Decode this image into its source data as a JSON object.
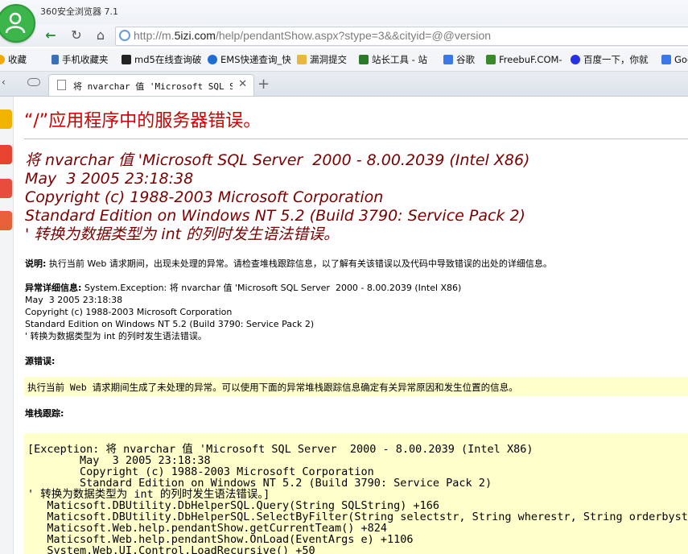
{
  "window": {
    "title": "360安全浏览器 7.1"
  },
  "address_bar": {
    "url_prefix": "http://m.",
    "url_domain": "5izi.com",
    "url_rest": "/help/pendantShow.aspx?stype=3&&cityid=@@version"
  },
  "bookmarks": [
    {
      "label": "收藏",
      "icon": "favorites-icon",
      "color": "#f2a900"
    },
    {
      "label": "手机收藏夹",
      "icon": "phone-icon",
      "color": "#3b6fb6"
    },
    {
      "label": "md5在线查询破",
      "icon": "grid-icon",
      "color": "#222222"
    },
    {
      "label": "EMS快递查询_快",
      "icon": "ie-icon",
      "color": "#1e6fd0"
    },
    {
      "label": "漏洞提交",
      "icon": "folder-icon",
      "color": "#e7b740"
    },
    {
      "label": "站长工具 - 站",
      "icon": "chart-icon",
      "color": "#2a7a2a"
    },
    {
      "label": "谷歌",
      "icon": "google-icon",
      "color": "#3b78e7"
    },
    {
      "label": "FreebuF.COM-",
      "icon": "freebuf-icon",
      "color": "#3a8a2a"
    },
    {
      "label": "百度一下，你就",
      "icon": "baidu-icon",
      "color": "#2932e1"
    },
    {
      "label": "Goo",
      "icon": "google-icon",
      "color": "#3b78e7"
    }
  ],
  "tab": {
    "label": "将 nvarchar 值 'Microsoft SQL Serv"
  },
  "page": {
    "title": "“/”应用程序中的服务器错误。",
    "error_message": [
      "将 nvarchar 值 'Microsoft SQL Server  2000 - 8.00.2039 (Intel X86)",
      "May  3 2005 23:18:38",
      "Copyright (c) 1988-2003 Microsoft Corporation",
      "Standard Edition on Windows NT 5.2 (Build 3790: Service Pack 2)",
      "' 转换为数据类型为 int 的列时发生语法错误。"
    ],
    "description_label": "说明:",
    "description_text": " 执行当前 Web 请求期间，出现未处理的异常。请检查堆栈跟踪信息，以了解有关该错误以及代码中导致错误的出处的详细信息。",
    "exception_label": "异常详细信息:",
    "exception_lines": [
      " System.Exception: 将 nvarchar 值 'Microsoft SQL Server  2000 - 8.00.2039 (Intel X86)",
      "May  3 2005 23:18:38",
      "Copyright (c) 1988-2003 Microsoft Corporation",
      "Standard Edition on Windows NT 5.2 (Build 3790: Service Pack 2)",
      "' 转换为数据类型为 int 的列时发生语法错误。"
    ],
    "source_error_label": "源错误:",
    "source_error_text": "执行当前 Web 请求期间生成了未处理的异常。可以使用下面的异常堆栈跟踪信息确定有关异常原因和发生位置的信息。",
    "stack_trace_label": "堆栈跟踪:",
    "stack_trace_lines": [
      "[Exception: 将 nvarchar 值 'Microsoft SQL Server  2000 - 8.00.2039 (Intel X86)",
      "        May  3 2005 23:18:38",
      "        Copyright (c) 1988-2003 Microsoft Corporation",
      "        Standard Edition on Windows NT 5.2 (Build 3790: Service Pack 2)",
      "' 转换为数据类型为 int 的列时发生语法错误。]",
      "   Maticsoft.DBUtility.DbHelperSQL.Query(String SQLString) +166",
      "   Maticsoft.DBUtility.DbHelperSQL.SelectByFilter(String selectstr, String wherestr, String orderbystr,",
      "   Maticsoft.Web.help.pendantShow.getCurrentTeam() +824",
      "   Maticsoft.Web.help.pendantShow.OnLoad(EventArgs e) +1106",
      "   System.Web.UI.Control.LoadRecursive() +50"
    ]
  },
  "colors": {
    "title_red": "#cc0000",
    "message_red": "#7a0000",
    "code_bg": "#ffffcc",
    "browser_green": "#3cb54a"
  }
}
